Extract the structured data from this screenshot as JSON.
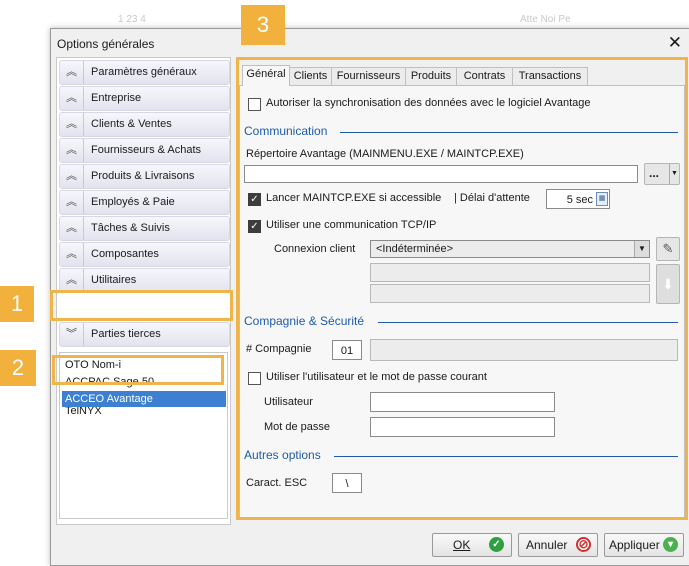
{
  "background_hints": [
    "1   23   4",
    "Atte Noi Pe"
  ],
  "window": {
    "title": "Options générales"
  },
  "left_menu": {
    "items": [
      {
        "label": "Paramètres généraux",
        "icon": "chevron-up-double-icon"
      },
      {
        "label": "Entreprise",
        "icon": "chevron-up-double-icon"
      },
      {
        "label": "Clients & Ventes",
        "icon": "chevron-up-double-icon"
      },
      {
        "label": "Fournisseurs & Achats",
        "icon": "chevron-up-double-icon"
      },
      {
        "label": "Produits & Livraisons",
        "icon": "chevron-up-double-icon"
      },
      {
        "label": "Employés & Paie",
        "icon": "chevron-up-double-icon"
      },
      {
        "label": "Tâches & Suivis",
        "icon": "chevron-up-double-icon"
      },
      {
        "label": "Composantes",
        "icon": "chevron-up-double-icon"
      },
      {
        "label": "Utilitaires",
        "icon": "chevron-up-double-icon"
      },
      {
        "label": "Parties tierces",
        "icon": "chevron-down-double-icon"
      }
    ],
    "sub_items": [
      {
        "label": "OTO Nom-i",
        "selected": false
      },
      {
        "label": "ACCPAC Sage 50",
        "selected": false
      },
      {
        "label": "ACCEO Avantage",
        "selected": true
      },
      {
        "label": "TelNYX",
        "selected": false
      }
    ]
  },
  "tabs": [
    "Général",
    "Clients",
    "Fournisseurs",
    "Produits",
    "Contrats",
    "Transactions"
  ],
  "active_tab": "Général",
  "general": {
    "sync_label": "Autoriser la synchronisation des données avec le logiciel Avantage",
    "sync_checked": false,
    "communication": {
      "title": "Communication",
      "directory_label": "Répertoire Avantage (MAINMENU.EXE / MAINTCP.EXE)",
      "directory_value": "",
      "browse_label": "...",
      "launch_label": "Lancer MAINTCP.EXE si accessible",
      "launch_checked": true,
      "delay_label": "| Délai d'attente",
      "delay_value": "5 sec",
      "tcp_label": "Utiliser une communication TCP/IP",
      "tcp_checked": true,
      "client_label": "Connexion client",
      "client_value": "<Indéterminée>"
    },
    "company": {
      "title": "Compagnie & Sécurité",
      "company_number_label": "# Compagnie",
      "company_number_value": "01",
      "use_current_user_label": "Utiliser l'utilisateur et le mot de passe courant",
      "use_current_user_checked": false,
      "user_label": "Utilisateur",
      "password_label": "Mot de passe"
    },
    "other": {
      "title": "Autres options",
      "esc_label": "Caract. ESC",
      "esc_value": "\\"
    }
  },
  "buttons": {
    "ok": "OK",
    "cancel": "Annuler",
    "apply": "Appliquer"
  },
  "annotations": [
    "1",
    "2",
    "3"
  ],
  "colors": {
    "highlight": "#f0b54a",
    "section_title": "#1f5ba8",
    "selection": "#3d7fd1",
    "ok_icon": "#2ea043",
    "cancel_icon": "#d32f2f",
    "apply_icon": "#4caf50"
  }
}
